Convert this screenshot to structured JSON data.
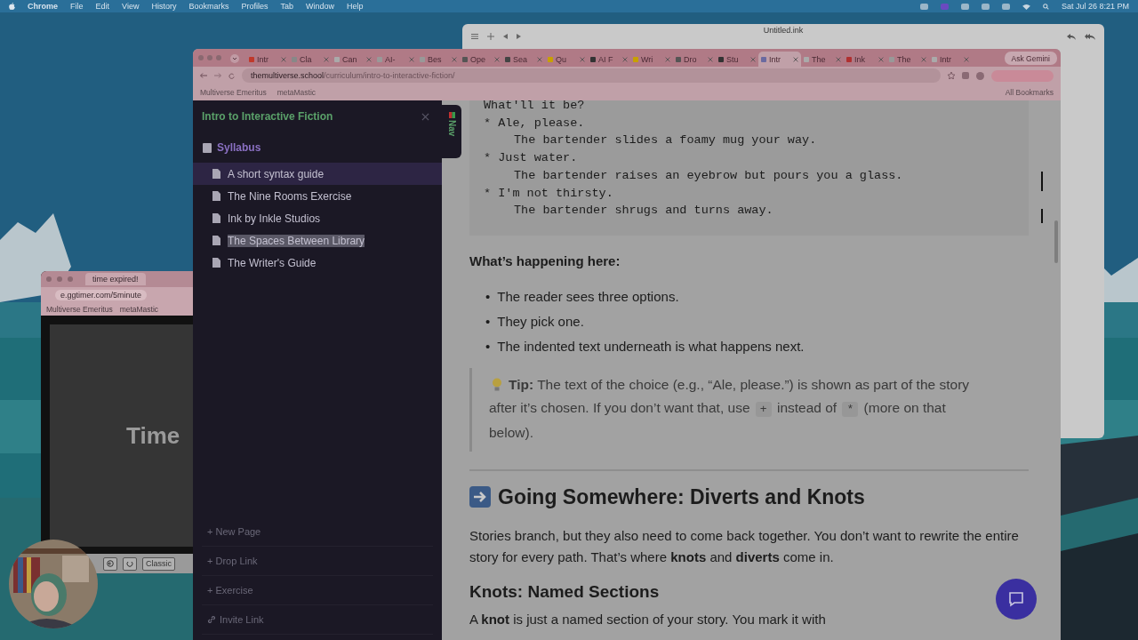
{
  "menu_bar": {
    "app": "Chrome",
    "menus": [
      "File",
      "Edit",
      "View",
      "History",
      "Bookmarks",
      "Profiles",
      "Tab",
      "Window",
      "Help"
    ],
    "clock": "Sat Jul 26  8:21 PM"
  },
  "ink_window": {
    "title": "Untitled.ink"
  },
  "timer_window": {
    "tab": "time expired!",
    "url": "e.ggtimer.com/5minute",
    "bookmarks": [
      "Multiverse Emeritus",
      "metaMastic"
    ],
    "display": "Time",
    "mode": "Classic"
  },
  "browser": {
    "tabs": [
      {
        "label": "Intr",
        "selected": false
      },
      {
        "label": "Cla",
        "selected": false
      },
      {
        "label": "Can",
        "selected": false
      },
      {
        "label": "AI-",
        "selected": false
      },
      {
        "label": "Bes",
        "selected": false
      },
      {
        "label": "Ope",
        "selected": false
      },
      {
        "label": "Sea",
        "selected": false
      },
      {
        "label": "Qu",
        "selected": false
      },
      {
        "label": "AI F",
        "selected": false
      },
      {
        "label": "Wri",
        "selected": false
      },
      {
        "label": "Dro",
        "selected": false
      },
      {
        "label": "Stu",
        "selected": false
      },
      {
        "label": "Intr",
        "selected": true
      },
      {
        "label": "The",
        "selected": false
      },
      {
        "label": "Ink",
        "selected": false
      },
      {
        "label": "The",
        "selected": false
      },
      {
        "label": "Intr",
        "selected": false
      }
    ],
    "gemini": "Ask Gemini",
    "url_host": "themultiverse.school",
    "url_path": "/curriculum/intro-to-interactive-fiction/",
    "bookmarks": [
      "Multiverse Emeritus",
      "metaMastic"
    ],
    "all_bookmarks": "All Bookmarks"
  },
  "sidebar": {
    "title": "Intro to Interactive Fiction",
    "nav_tab": "Nav",
    "section": "Syllabus",
    "items": [
      {
        "label": "A short syntax guide",
        "selected": true,
        "highlighted": false
      },
      {
        "label": "The Nine Rooms Exercise",
        "selected": false,
        "highlighted": false
      },
      {
        "label": "Ink by Inkle Studios",
        "selected": false,
        "highlighted": false
      },
      {
        "label": "The Spaces Between Library",
        "selected": false,
        "highlighted": true
      },
      {
        "label": "The Writer's Guide",
        "selected": false,
        "highlighted": false
      }
    ],
    "actions": [
      {
        "label": "+ New Page",
        "kind": "add"
      },
      {
        "label": "+ Drop Link",
        "kind": "add"
      },
      {
        "label": "+ Exercise",
        "kind": "add"
      },
      {
        "label": "Invite Link",
        "kind": "link"
      }
    ]
  },
  "content": {
    "code_lines": [
      {
        "text": "What'll it be?",
        "kind": "prompt"
      },
      {
        "text": "* Ale, please.",
        "kind": "choice"
      },
      {
        "text": "The bartender slides a foamy mug your way.",
        "kind": "result"
      },
      {
        "text": "* Just water.",
        "kind": "choice"
      },
      {
        "text": "The bartender raises an eyebrow but pours you a glass.",
        "kind": "result"
      },
      {
        "text": "* I'm not thirsty.",
        "kind": "choice"
      },
      {
        "text": "The bartender shrugs and turns away.",
        "kind": "result"
      }
    ],
    "explain_heading": "What’s happening here:",
    "bullet_marker": "•",
    "bullets": [
      "The reader sees three options.",
      "They pick one.",
      "The indented text underneath is what happens next."
    ],
    "tip": [
      {
        "kind": "text",
        "text": "**Tip:** The text of the choice (e.g., “Ale, please.”) is shown as part of the story after it’s chosen. If you don’t want that, use "
      },
      {
        "kind": "code",
        "text": "+"
      },
      {
        "kind": "text",
        "text": " instead of "
      },
      {
        "kind": "code",
        "text": "*"
      },
      {
        "kind": "text",
        "text": " (more on that below)."
      }
    ],
    "section_heading": "Going Somewhere: Diverts and Knots",
    "paragraph": "Stories branch, but they also need to come back together. You don’t want to rewrite the entire story for every path. That’s where **knots** and **diverts** come in.",
    "subheading": "Knots: Named Sections",
    "last_line": "A **knot** is just a named section of your story. You mark it with"
  }
}
